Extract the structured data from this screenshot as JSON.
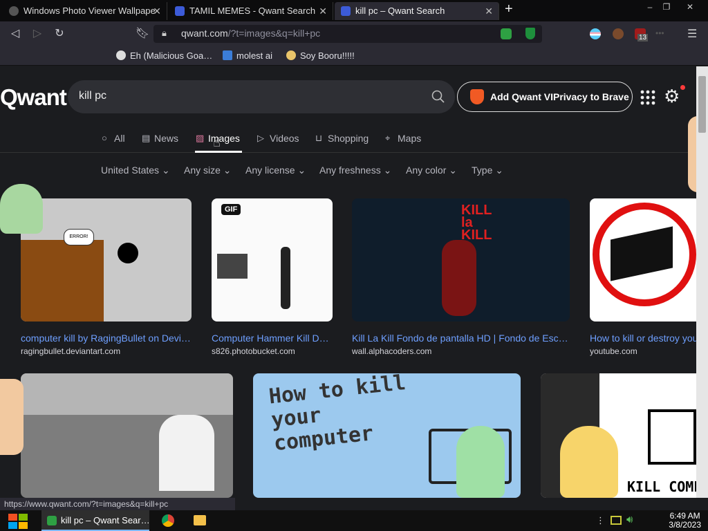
{
  "tabs": [
    {
      "title": "Windows Photo Viewer Wallpape",
      "active": false
    },
    {
      "title": "TAMIL MEMES - Qwant Search",
      "active": false
    },
    {
      "title": "kill pc – Qwant Search",
      "active": true
    }
  ],
  "new_tab": "+",
  "window_controls": {
    "min": "–",
    "max": "❐",
    "close": "✕"
  },
  "address": {
    "domain": "qwant.com",
    "path": "/?t=images&q=kill+pc"
  },
  "bookmarks": [
    "Eh (Malicious Goa…",
    "molest ai",
    "Soy Booru!!!!!"
  ],
  "extension_badge": "13",
  "logo": "Qwant",
  "search": {
    "value": "kill pc"
  },
  "brave_button": "Add Qwant VIPrivacy to Brave",
  "nav_tabs": [
    "All",
    "News",
    "Images",
    "Videos",
    "Shopping",
    "Maps"
  ],
  "filters": [
    "United States",
    "Any size",
    "Any license",
    "Any freshness",
    "Any color",
    "Type"
  ],
  "results_row1": [
    {
      "title": "computer kill by RagingBullet on Devi…",
      "source": "ragingbullet.deviantart.com"
    },
    {
      "title": "Computer Hammer Kill D…",
      "source": "s826.photobucket.com",
      "badge": "GIF"
    },
    {
      "title": "Kill La Kill Fondo de pantalla HD | Fondo de Esc…",
      "source": "wall.alphacoders.com"
    },
    {
      "title": "How to kill or destroy you",
      "source": "youtube.com"
    }
  ],
  "image_text": {
    "bubble_error": "ERROR!",
    "kill_la_kill": "KILL la KILL",
    "how_to_kill": "How to kill your computer",
    "kill_compu": "KILL COMPU"
  },
  "status_url": "https://www.qwant.com/?t=images&q=kill+pc",
  "taskbar": {
    "window_title": "kill pc – Qwant Sear…"
  },
  "clock": {
    "time": "6:49 AM",
    "date": "3/8/2023"
  },
  "colors": {
    "accent_link": "#6e9fff",
    "background": "#1b1c1f"
  }
}
